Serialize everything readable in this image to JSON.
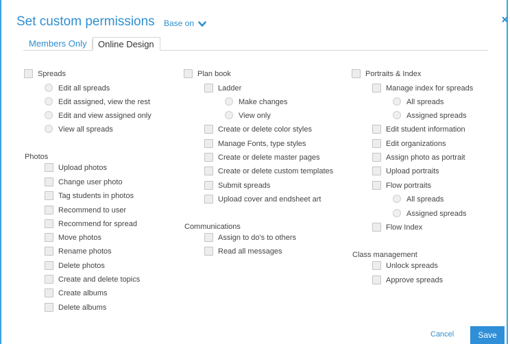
{
  "header": {
    "title": "Set custom permissions",
    "base_on": "Base on"
  },
  "tabs": [
    "Members Only",
    "Online Design"
  ],
  "col1": {
    "spreads_label": "Spreads",
    "spreads_items": [
      "Edit all spreads",
      "Edit assigned, view the rest",
      "Edit and view assigned only",
      "View all spreads"
    ],
    "photos_header": "Photos",
    "photos_items": [
      "Upload photos",
      "Change user photo",
      "Tag students in photos",
      "Recommend to user",
      "Recommend for spread",
      "Move photos",
      "Rename photos",
      "Delete photos",
      "Create and delete topics",
      "Create albums",
      "Delete albums"
    ]
  },
  "col2": {
    "plan_label": "Plan book",
    "ladder_label": "Ladder",
    "ladder_items": [
      "Make changes",
      "View only"
    ],
    "plan_items": [
      "Create or delete color styles",
      "Manage Fonts, type styles",
      "Create or delete master pages",
      "Create or delete custom templates",
      "Submit spreads",
      "Upload cover and endsheet art"
    ],
    "comm_header": "Communications",
    "comm_items": [
      "Assign to do's to others",
      "Read all messages"
    ]
  },
  "col3": {
    "portraits_label": "Portraits & Index",
    "manage_index": "Manage index for spreads",
    "index_radios": [
      "All spreads",
      "Assigned spreads"
    ],
    "portrait_items": [
      "Edit student information",
      "Edit organizations",
      "Assign photo as portrait",
      "Upload portraits"
    ],
    "flow_portraits": "Flow portraits",
    "flow_radios": [
      "All spreads",
      "Assigned spreads"
    ],
    "flow_index": "Flow Index",
    "class_header": "Class management",
    "class_items": [
      "Unlock spreads",
      "Approve spreads"
    ]
  },
  "footer": {
    "cancel": "Cancel",
    "save": "Save"
  }
}
